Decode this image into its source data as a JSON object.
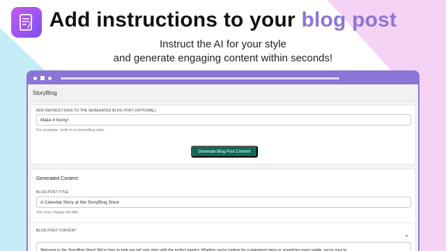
{
  "hero": {
    "title_main": "Add instructions to your ",
    "title_accent": "blog post",
    "subtitle_line1": "Instruct the AI for your style",
    "subtitle_line2": "and generate engaging content within seconds!"
  },
  "app": {
    "name": "StoryBlog"
  },
  "instructions_card": {
    "label": "ADD INSTRUCTIONS TO THE GENERATED BLOG POST (OPTIONAL)",
    "input_value": "Make it funny!",
    "hint": "For example: 'write in a storytelling style'",
    "button_label": "Generate Blog Post Content"
  },
  "generated_card": {
    "section_title": "Generated Content",
    "title_label": "BLOG POST TITLE",
    "title_value": "A Celestial Story at the StoryBlog Store",
    "title_hint": "You may change the title",
    "content_label": "BLOG POST CONTENT",
    "content_value": "Welcome to the StoryBlog Store! We're here to help you tell your story with the perfect jewelry. Whether you're looking for a statement piece or something more subtle, you're sure to"
  },
  "colors": {
    "accent": "#8a75d8",
    "button": "#0f6b5c",
    "logo_start": "#c35cf0",
    "logo_end": "#7c4ff0",
    "bg_left": "#c6ecf7",
    "bg_right": "#f4d3f4"
  },
  "icons": {
    "logo": "document-quill-icon",
    "scroll": "scroll-up-arrow-icon"
  }
}
